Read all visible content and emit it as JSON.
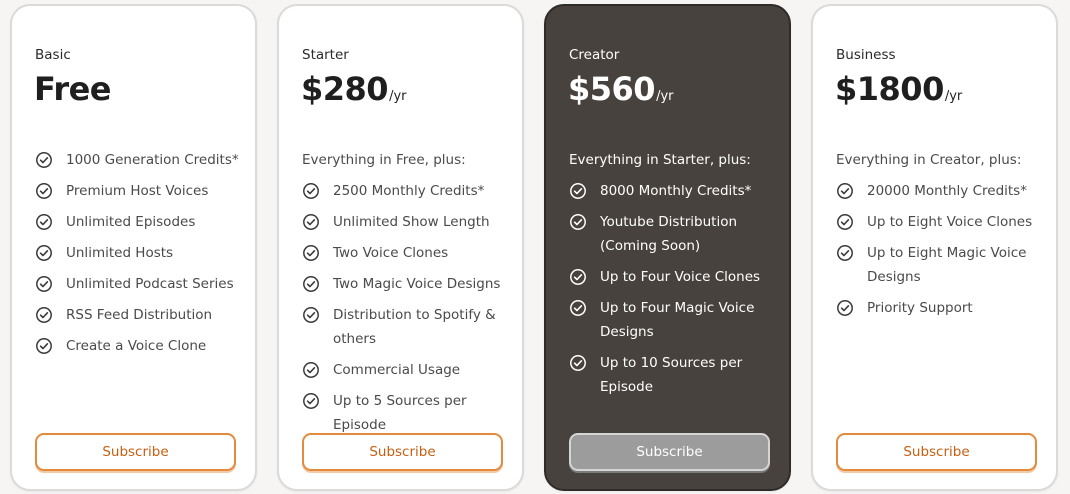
{
  "plans": [
    {
      "name": "Basic",
      "price": "Free",
      "period": "",
      "intro": "",
      "features": [
        "1000 Generation Credits*",
        "Premium Host Voices",
        "Unlimited Episodes",
        "Unlimited Hosts",
        "Unlimited Podcast Series",
        "RSS Feed Distribution",
        "Create a Voice Clone"
      ],
      "button_label": "Subscribe",
      "featured": false
    },
    {
      "name": "Starter",
      "price": "$280",
      "period": "/yr",
      "intro": "Everything in Free, plus:",
      "features": [
        "2500 Monthly Credits*",
        "Unlimited Show Length",
        "Two Voice Clones",
        "Two Magic Voice Designs",
        "Distribution to Spotify & others",
        "Commercial Usage",
        "Up to 5 Sources per Episode"
      ],
      "button_label": "Subscribe",
      "featured": false
    },
    {
      "name": "Creator",
      "price": "$560",
      "period": "/yr",
      "intro": "Everything in Starter, plus:",
      "features": [
        "8000 Monthly Credits*",
        "Youtube Distribution (Coming Soon)",
        "Up to Four Voice Clones",
        "Up to Four Magic Voice Designs",
        "Up to 10 Sources per Episode"
      ],
      "button_label": "Subscribe",
      "featured": true
    },
    {
      "name": "Business",
      "price": "$1800",
      "period": "/yr",
      "intro": "Everything in Creator, plus:",
      "features": [
        "20000 Monthly Credits*",
        "Up to Eight Voice Clones",
        "Up to Eight Magic Voice Designs",
        "Priority Support"
      ],
      "button_label": "Subscribe",
      "featured": false
    }
  ],
  "icons": {
    "feature": "check-circle-icon"
  },
  "colors": {
    "accent": "#e38a3c",
    "accent_text": "#c75f12",
    "featured_background": "#48423e",
    "featured_button": "#9c9c9c",
    "card_background": "#ffffff",
    "page_background": "#f6f5f4"
  }
}
